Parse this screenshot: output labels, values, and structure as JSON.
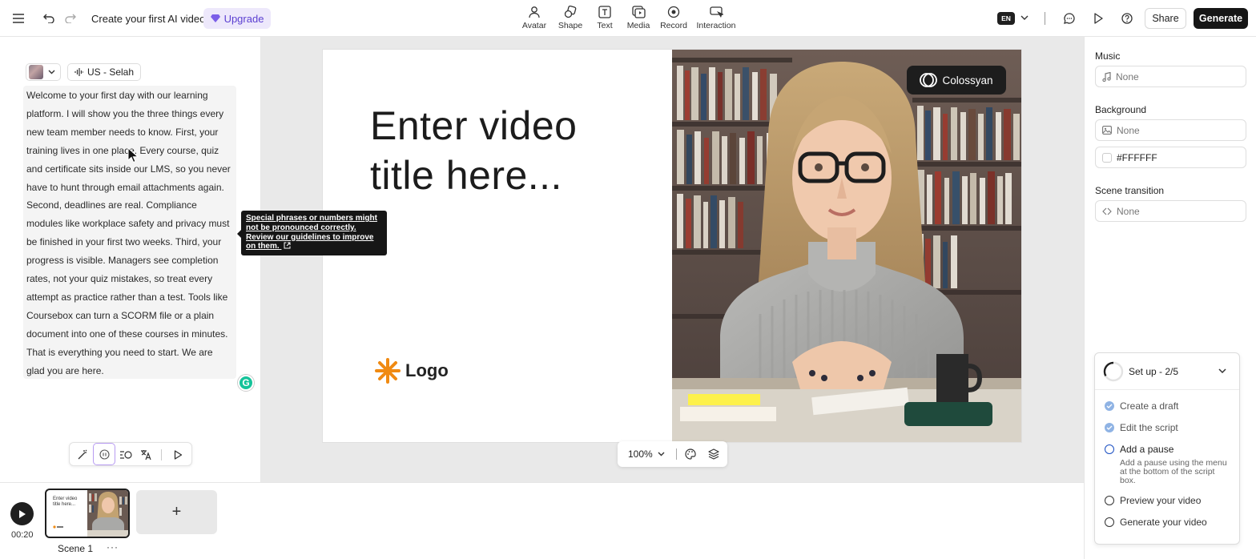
{
  "header": {
    "title": "Create your first AI video",
    "upgrade_label": "Upgrade",
    "tools": [
      {
        "label": "Avatar",
        "icon": "avatar-icon"
      },
      {
        "label": "Shape",
        "icon": "shape-icon"
      },
      {
        "label": "Text",
        "icon": "text-icon"
      },
      {
        "label": "Media",
        "icon": "media-icon"
      },
      {
        "label": "Record",
        "icon": "record-icon"
      },
      {
        "label": "Interaction",
        "icon": "interaction-icon"
      }
    ],
    "language": "EN",
    "share_label": "Share",
    "generate_label": "Generate"
  },
  "script": {
    "voice_label": "US - Selah",
    "text": "Welcome to your first day with our learning platform. I will show you the three things every new team member needs to know. First, your training lives in one place. Every course, quiz and certificate sits inside our LMS, so you never have to hunt through email attachments again. Second, deadlines are real. Compliance modules like workplace safety and privacy must be finished in your first two weeks. Third, your progress is visible. Managers see completion rates, not your quiz mistakes, so treat every attempt as practice rather than a test. Tools like Coursebox can turn a SCORM file or a plain document into one of these courses in minutes. That is everything you need to start. We are glad you are here.",
    "tooltip": "Special phrases or numbers might not be pronounced correctly. Review our guidelines to improve on them."
  },
  "slide": {
    "title": "Enter video title here...",
    "logo_text": "Logo",
    "brand_text": "Colossyan"
  },
  "canvas": {
    "zoom": "100%"
  },
  "right_panel": {
    "music_label": "Music",
    "music_value": "None",
    "background_label": "Background",
    "background_value": "None",
    "background_color": "#FFFFFF",
    "transition_label": "Scene transition",
    "transition_value": "None"
  },
  "checklist": {
    "title": "Set up - 2/5",
    "items": [
      {
        "label": "Create a draft",
        "done": true
      },
      {
        "label": "Edit the script",
        "done": true
      },
      {
        "label": "Add a pause",
        "done": false
      },
      {
        "label": "Preview your video",
        "done": false
      },
      {
        "label": "Generate your video",
        "done": false
      }
    ],
    "add_pause_desc": "Add a pause using the menu at the bottom of the script box."
  },
  "timeline": {
    "duration": "00:20",
    "scene_label": "Scene 1",
    "thumb_title": "Enter video title here...",
    "add_label": "+",
    "more_label": "···"
  },
  "colors": {
    "accent": "#5b3fd1",
    "upgrade_bg": "#ede8fb",
    "dark": "#161616"
  }
}
